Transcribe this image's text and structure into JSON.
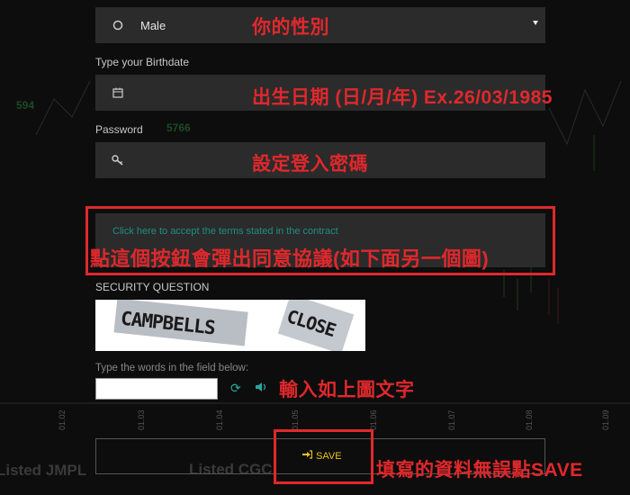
{
  "gender": {
    "icon": "radio-icon",
    "value": "Male",
    "annotation": "你的性別"
  },
  "birthdate": {
    "label": "Type your Birthdate",
    "icon": "calendar-icon",
    "annotation": "出生日期 (日/月/年) Ex.26/03/1985"
  },
  "password": {
    "label": "Password",
    "icon": "key-icon",
    "annotation": "設定登入密碼"
  },
  "terms": {
    "link_text": "Click here to accept the terms stated in the contract",
    "annotation": "點這個按鈕會彈出同意協議(如下面另一個圖)"
  },
  "security": {
    "title": "SECURITY QUESTION",
    "captcha_words": [
      "CAMPBELLS",
      "CLOSE"
    ],
    "instruction": "Type the words in the field below:",
    "annotation": "輸入如上圖文字",
    "refresh_icon": "refresh-icon",
    "audio_icon": "speaker-icon"
  },
  "save": {
    "label": "SAVE",
    "icon": "sign-in-icon",
    "annotation": "填寫的資料無誤點SAVE"
  },
  "background": {
    "dates": [
      "01.02",
      "01.03",
      "01.04",
      "01.05",
      "01.06",
      "01.07",
      "01.08",
      "01.09"
    ],
    "tickers": [
      "Listed JMPL",
      "Listed CGC"
    ],
    "numbers": [
      "594",
      "5766"
    ]
  },
  "colors": {
    "annotation_red": "#e0282c",
    "accent_teal": "#26a69a",
    "save_yellow": "#e8c21a"
  }
}
